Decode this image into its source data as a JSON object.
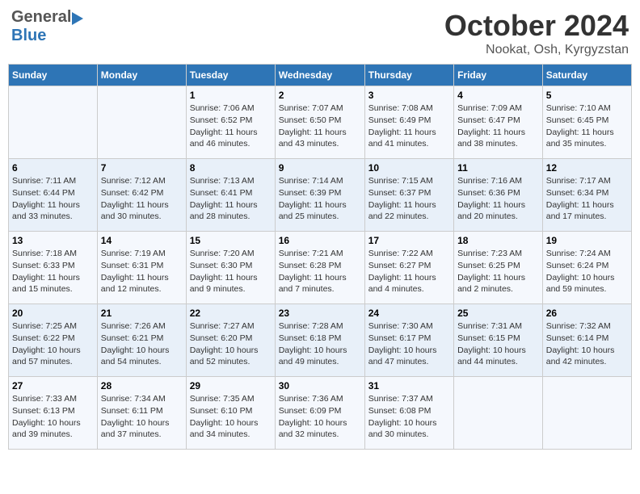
{
  "header": {
    "logo_general": "General",
    "logo_blue": "Blue",
    "month": "October 2024",
    "location": "Nookat, Osh, Kyrgyzstan"
  },
  "days_of_week": [
    "Sunday",
    "Monday",
    "Tuesday",
    "Wednesday",
    "Thursday",
    "Friday",
    "Saturday"
  ],
  "weeks": [
    [
      {
        "day": "",
        "info": ""
      },
      {
        "day": "",
        "info": ""
      },
      {
        "day": "1",
        "info": "Sunrise: 7:06 AM\nSunset: 6:52 PM\nDaylight: 11 hours and 46 minutes."
      },
      {
        "day": "2",
        "info": "Sunrise: 7:07 AM\nSunset: 6:50 PM\nDaylight: 11 hours and 43 minutes."
      },
      {
        "day": "3",
        "info": "Sunrise: 7:08 AM\nSunset: 6:49 PM\nDaylight: 11 hours and 41 minutes."
      },
      {
        "day": "4",
        "info": "Sunrise: 7:09 AM\nSunset: 6:47 PM\nDaylight: 11 hours and 38 minutes."
      },
      {
        "day": "5",
        "info": "Sunrise: 7:10 AM\nSunset: 6:45 PM\nDaylight: 11 hours and 35 minutes."
      }
    ],
    [
      {
        "day": "6",
        "info": "Sunrise: 7:11 AM\nSunset: 6:44 PM\nDaylight: 11 hours and 33 minutes."
      },
      {
        "day": "7",
        "info": "Sunrise: 7:12 AM\nSunset: 6:42 PM\nDaylight: 11 hours and 30 minutes."
      },
      {
        "day": "8",
        "info": "Sunrise: 7:13 AM\nSunset: 6:41 PM\nDaylight: 11 hours and 28 minutes."
      },
      {
        "day": "9",
        "info": "Sunrise: 7:14 AM\nSunset: 6:39 PM\nDaylight: 11 hours and 25 minutes."
      },
      {
        "day": "10",
        "info": "Sunrise: 7:15 AM\nSunset: 6:37 PM\nDaylight: 11 hours and 22 minutes."
      },
      {
        "day": "11",
        "info": "Sunrise: 7:16 AM\nSunset: 6:36 PM\nDaylight: 11 hours and 20 minutes."
      },
      {
        "day": "12",
        "info": "Sunrise: 7:17 AM\nSunset: 6:34 PM\nDaylight: 11 hours and 17 minutes."
      }
    ],
    [
      {
        "day": "13",
        "info": "Sunrise: 7:18 AM\nSunset: 6:33 PM\nDaylight: 11 hours and 15 minutes."
      },
      {
        "day": "14",
        "info": "Sunrise: 7:19 AM\nSunset: 6:31 PM\nDaylight: 11 hours and 12 minutes."
      },
      {
        "day": "15",
        "info": "Sunrise: 7:20 AM\nSunset: 6:30 PM\nDaylight: 11 hours and 9 minutes."
      },
      {
        "day": "16",
        "info": "Sunrise: 7:21 AM\nSunset: 6:28 PM\nDaylight: 11 hours and 7 minutes."
      },
      {
        "day": "17",
        "info": "Sunrise: 7:22 AM\nSunset: 6:27 PM\nDaylight: 11 hours and 4 minutes."
      },
      {
        "day": "18",
        "info": "Sunrise: 7:23 AM\nSunset: 6:25 PM\nDaylight: 11 hours and 2 minutes."
      },
      {
        "day": "19",
        "info": "Sunrise: 7:24 AM\nSunset: 6:24 PM\nDaylight: 10 hours and 59 minutes."
      }
    ],
    [
      {
        "day": "20",
        "info": "Sunrise: 7:25 AM\nSunset: 6:22 PM\nDaylight: 10 hours and 57 minutes."
      },
      {
        "day": "21",
        "info": "Sunrise: 7:26 AM\nSunset: 6:21 PM\nDaylight: 10 hours and 54 minutes."
      },
      {
        "day": "22",
        "info": "Sunrise: 7:27 AM\nSunset: 6:20 PM\nDaylight: 10 hours and 52 minutes."
      },
      {
        "day": "23",
        "info": "Sunrise: 7:28 AM\nSunset: 6:18 PM\nDaylight: 10 hours and 49 minutes."
      },
      {
        "day": "24",
        "info": "Sunrise: 7:30 AM\nSunset: 6:17 PM\nDaylight: 10 hours and 47 minutes."
      },
      {
        "day": "25",
        "info": "Sunrise: 7:31 AM\nSunset: 6:15 PM\nDaylight: 10 hours and 44 minutes."
      },
      {
        "day": "26",
        "info": "Sunrise: 7:32 AM\nSunset: 6:14 PM\nDaylight: 10 hours and 42 minutes."
      }
    ],
    [
      {
        "day": "27",
        "info": "Sunrise: 7:33 AM\nSunset: 6:13 PM\nDaylight: 10 hours and 39 minutes."
      },
      {
        "day": "28",
        "info": "Sunrise: 7:34 AM\nSunset: 6:11 PM\nDaylight: 10 hours and 37 minutes."
      },
      {
        "day": "29",
        "info": "Sunrise: 7:35 AM\nSunset: 6:10 PM\nDaylight: 10 hours and 34 minutes."
      },
      {
        "day": "30",
        "info": "Sunrise: 7:36 AM\nSunset: 6:09 PM\nDaylight: 10 hours and 32 minutes."
      },
      {
        "day": "31",
        "info": "Sunrise: 7:37 AM\nSunset: 6:08 PM\nDaylight: 10 hours and 30 minutes."
      },
      {
        "day": "",
        "info": ""
      },
      {
        "day": "",
        "info": ""
      }
    ]
  ]
}
